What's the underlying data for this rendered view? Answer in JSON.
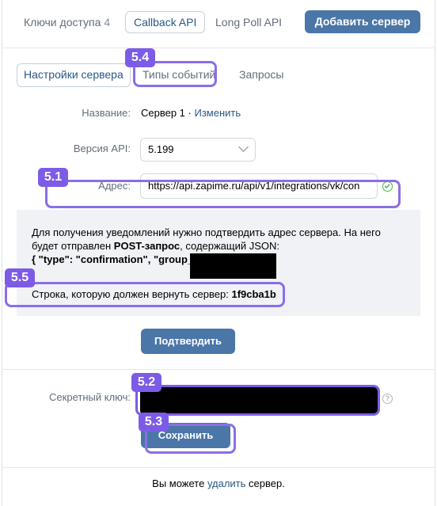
{
  "top_tabs": {
    "keys_label": "Ключи доступа",
    "keys_count": "4",
    "callback_label": "Callback API",
    "longpoll_label": "Long Poll API",
    "add_server_label": "Добавить сервер"
  },
  "sub_tabs": {
    "settings": "Настройки сервера",
    "events": "Типы событий",
    "requests": "Запросы"
  },
  "form": {
    "name_label": "Название:",
    "name_value": "Сервер 1",
    "name_sep": " · ",
    "name_edit": "Изменить",
    "version_label": "Версия API:",
    "version_value": "5.199",
    "address_label": "Адрес:",
    "address_value": "https://api.zapime.ru/api/v1/integrations/vk/con"
  },
  "info": {
    "line1": "Для получения уведомлений нужно подтвердить адрес сервера. На него",
    "line2_pre": "будет отправлен ",
    "line2_bold": "POST-запрос",
    "line2_post": ", содержащий JSON:",
    "json_line": "{ \"type\": \"confirmation\", \"group_id\":",
    "confirm_pre": "Строка, которую должен вернуть сервер: ",
    "confirm_code": "1f9cba1b"
  },
  "confirm_button": "Подтвердить",
  "secret": {
    "label": "Секретный ключ:",
    "save_button": "Сохранить"
  },
  "footer": {
    "pre": "Вы можете ",
    "link": "удалить",
    "post": " сервер."
  },
  "annotations": [
    "5.4",
    "5.1",
    "5.5",
    "5.2",
    "5.3"
  ],
  "colors": {
    "accent": "#4a76a8",
    "link": "#2a5885",
    "annotation": "#7c5ce6",
    "ok": "#4bb34b"
  }
}
